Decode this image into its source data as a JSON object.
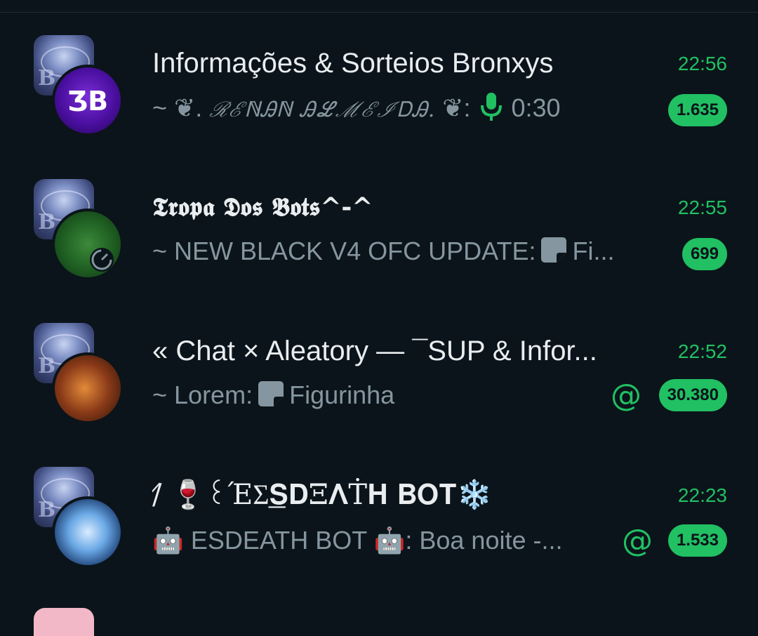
{
  "chats": [
    {
      "title": "Informações & Sorteios Bronxys",
      "time": "22:56",
      "preview_prefix": "~ ❦. ",
      "preview_sender": "ℛℰℕᎯℕ ᎯℒℳℰℐᎠᎯ.",
      "preview_suffix": " ❦:",
      "preview_duration": "0:30",
      "unread": "1.635",
      "avatar_label": "ƷB"
    },
    {
      "title": "𝕿𝖗𝖔𝖕𝖆 𝕯𝖔𝖘 𝕭𝖔𝖙𝖘^-^",
      "time": "22:55",
      "preview_text": "~ NEW BLACK V4 OFC UPDATE:",
      "preview_tail": "Fi...",
      "unread": "699"
    },
    {
      "title": "« Chat × Aleatory — ¯SUP & Infor...",
      "time": "22:52",
      "preview_text": "~ Lorem:",
      "preview_tail": "Figurinha",
      "mention": "@",
      "unread": "30.380"
    },
    {
      "title": "/̸ 🍷꒰ΈΣ͟𝐒𝐃Ξ𝚲Ṫ𝐇 𝐁𝐎𝐓❄️",
      "time": "22:23",
      "preview_text": "🤖 ESDEATH BOT 🤖: Boa noite -...",
      "mention": "@",
      "unread": "1.533"
    }
  ],
  "colors": {
    "background": "#0b141a",
    "accent": "#21c063",
    "title": "#e9edef",
    "preview": "#8696a0"
  },
  "icons": {
    "mic": "microphone-icon",
    "sticker": "sticker-icon",
    "mention": "mention-icon",
    "status": "status-icon"
  }
}
